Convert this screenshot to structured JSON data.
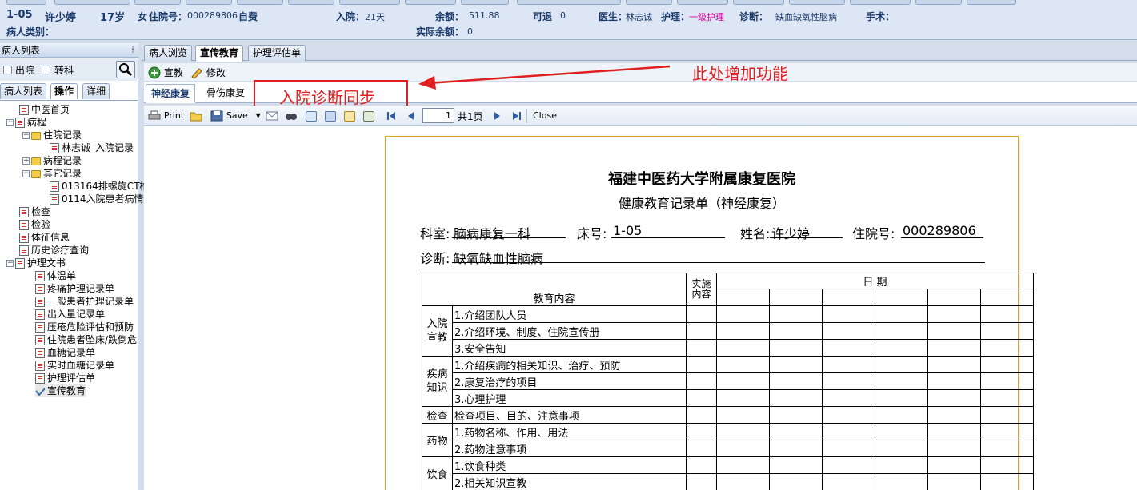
{
  "header": {
    "bed": "1-05",
    "name": "许少婷",
    "age": "17岁",
    "sex": "女",
    "admit_no_label": "住院号：",
    "admit_no": "000289806",
    "pay_type": "自费",
    "inpatient_label": "入院：",
    "inpatient_days": "21天",
    "balance_label": "余额：",
    "balance": "511.88",
    "refundable_label": "可退",
    "refundable": "0",
    "doctor_label": "医生：",
    "doctor": "林志诚",
    "nursing_label": "护理：",
    "nursing_level": "一级护理",
    "diagnosis_label": "诊断：",
    "diagnosis": "缺血缺氧性脑病",
    "surgery_label": "手术：",
    "category_label": "病人类别：",
    "actual_balance_label": "实际余额：",
    "actual_balance": "0"
  },
  "left_panel": {
    "title": "病人列表",
    "pin": "ᚽ",
    "discharged": "出院",
    "transfer": "转科",
    "tabs": [
      "病人列表",
      "操作",
      "详细"
    ]
  },
  "tree": [
    {
      "label": "中医首页"
    },
    {
      "label": "病程"
    },
    {
      "label": "住院记录"
    },
    {
      "label": "林志诚_入院记录"
    },
    {
      "label": "病程记录"
    },
    {
      "label": "其它记录"
    },
    {
      "label": "013164排螺旋CT椎"
    },
    {
      "label": "0114入院患者病情"
    },
    {
      "label": "检查"
    },
    {
      "label": "检验"
    },
    {
      "label": "体征信息"
    },
    {
      "label": "历史诊疗查询"
    },
    {
      "label": "护理文书"
    },
    {
      "label": "体温单"
    },
    {
      "label": "疼痛护理记录单"
    },
    {
      "label": "一般患者护理记录单"
    },
    {
      "label": "出入量记录单"
    },
    {
      "label": "压疮危险评估和预防"
    },
    {
      "label": "住院患者坠床/跌倒危"
    },
    {
      "label": "血糖记录单"
    },
    {
      "label": "实时血糖记录单"
    },
    {
      "label": "护理评估单"
    },
    {
      "label": "宣传教育"
    }
  ],
  "main_tabs": [
    "病人浏览",
    "宣传教育",
    "护理评估单"
  ],
  "op_bar": {
    "add": "宣教",
    "edit": "修改"
  },
  "sub_tabs": [
    "神经康复",
    "骨伤康复"
  ],
  "annotation": {
    "box_text": "入院诊断同步",
    "note": "此处增加功能"
  },
  "report_toolbar": {
    "print": "Print",
    "save": "Save",
    "page": "1",
    "total": "共1页",
    "close": "Close"
  },
  "document": {
    "hospital": "福建中医药大学附属康复医院",
    "form_title": "健康教育记录单（神经康复）",
    "dept_label": "科室:",
    "dept": "脑病康复一科",
    "bed_label": "床号:",
    "bed": "1-05",
    "name_label": "姓名:",
    "name": "许少婷",
    "admit_label": "住院号:",
    "admit_no": "000289806",
    "diag_label": "诊断:",
    "diag": "缺氧缺血性脑病",
    "col_content": "教育内容",
    "col_impl": "实施\n内容",
    "col_date": "日 期",
    "rows": [
      {
        "cat": "入院\n宣教",
        "items": [
          "1.介绍团队人员",
          "2.介绍环境、制度、住院宣传册",
          "3.安全告知"
        ]
      },
      {
        "cat": "疾病\n知识",
        "items": [
          "1.介绍疾病的相关知识、治疗、预防",
          "2.康复治疗的项目",
          "3.心理护理"
        ]
      },
      {
        "cat": "检查",
        "items": [
          "检查项目、目的、注意事项"
        ]
      },
      {
        "cat": "药物",
        "items": [
          "1.药物名称、作用、用法",
          "2.药物注意事项"
        ]
      },
      {
        "cat": "饮食",
        "items": [
          "1.饮食种类",
          "2.相关知识宣教"
        ]
      }
    ]
  }
}
